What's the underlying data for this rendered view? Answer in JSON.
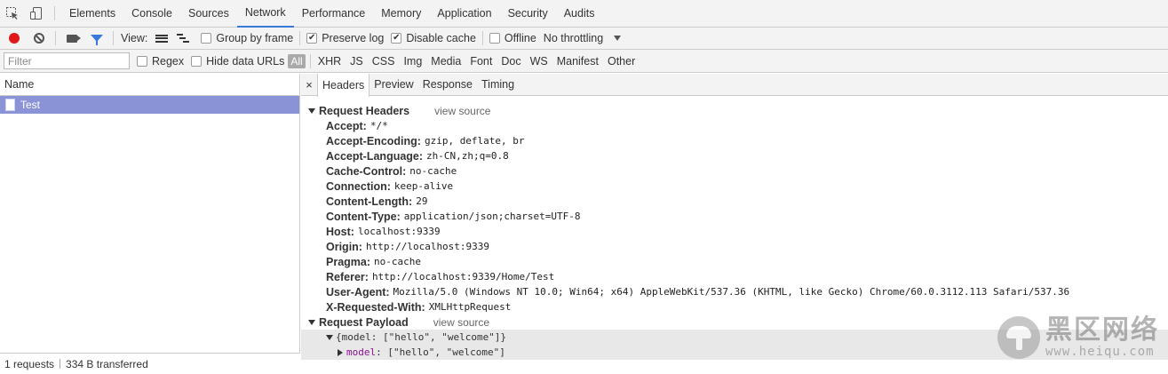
{
  "tabs": [
    "Elements",
    "Console",
    "Sources",
    "Network",
    "Performance",
    "Memory",
    "Application",
    "Security",
    "Audits"
  ],
  "toolbar": {
    "view_label": "View:",
    "group_by_frame": "Group by frame",
    "preserve_log": "Preserve log",
    "disable_cache": "Disable cache",
    "offline": "Offline",
    "throttling": "No throttling"
  },
  "filterbar": {
    "placeholder": "Filter",
    "regex": "Regex",
    "hide_data_urls": "Hide data URLs",
    "all": "All",
    "types": [
      "XHR",
      "JS",
      "CSS",
      "Img",
      "Media",
      "Font",
      "Doc",
      "WS",
      "Manifest",
      "Other"
    ]
  },
  "requests": {
    "name_header": "Name",
    "items": [
      "Test"
    ],
    "status": {
      "count": "1 requests",
      "transferred": "334 B transferred"
    }
  },
  "detail": {
    "close": "×",
    "tabs": [
      "Headers",
      "Preview",
      "Response",
      "Timing"
    ],
    "request_headers_title": "Request Headers",
    "view_source": "view source",
    "headers": [
      {
        "key": "Accept:",
        "value": "*/*"
      },
      {
        "key": "Accept-Encoding:",
        "value": "gzip, deflate, br"
      },
      {
        "key": "Accept-Language:",
        "value": "zh-CN,zh;q=0.8"
      },
      {
        "key": "Cache-Control:",
        "value": "no-cache"
      },
      {
        "key": "Connection:",
        "value": "keep-alive"
      },
      {
        "key": "Content-Length:",
        "value": "29"
      },
      {
        "key": "Content-Type:",
        "value": "application/json;charset=UTF-8"
      },
      {
        "key": "Host:",
        "value": "localhost:9339"
      },
      {
        "key": "Origin:",
        "value": "http://localhost:9339"
      },
      {
        "key": "Pragma:",
        "value": "no-cache"
      },
      {
        "key": "Referer:",
        "value": "http://localhost:9339/Home/Test"
      },
      {
        "key": "User-Agent:",
        "value": "Mozilla/5.0 (Windows NT 10.0; Win64; x64) AppleWebKit/537.36 (KHTML, like Gecko) Chrome/60.0.3112.113 Safari/537.36"
      },
      {
        "key": "X-Requested-With:",
        "value": "XMLHttpRequest"
      }
    ],
    "payload_title": "Request Payload",
    "payload_view_source": "view source",
    "payload_summary": "{model: [\"hello\", \"welcome\"]}",
    "payload_key": "model",
    "payload_value": ": [\"hello\", \"welcome\"]"
  },
  "watermark": {
    "cn": "黑区网络",
    "url": "www.heiqu.com"
  },
  "colors": {
    "accent": "#3879d9",
    "record": "#e01a1a",
    "selected_row": "#8a93d6",
    "payload_key": "#881391"
  }
}
